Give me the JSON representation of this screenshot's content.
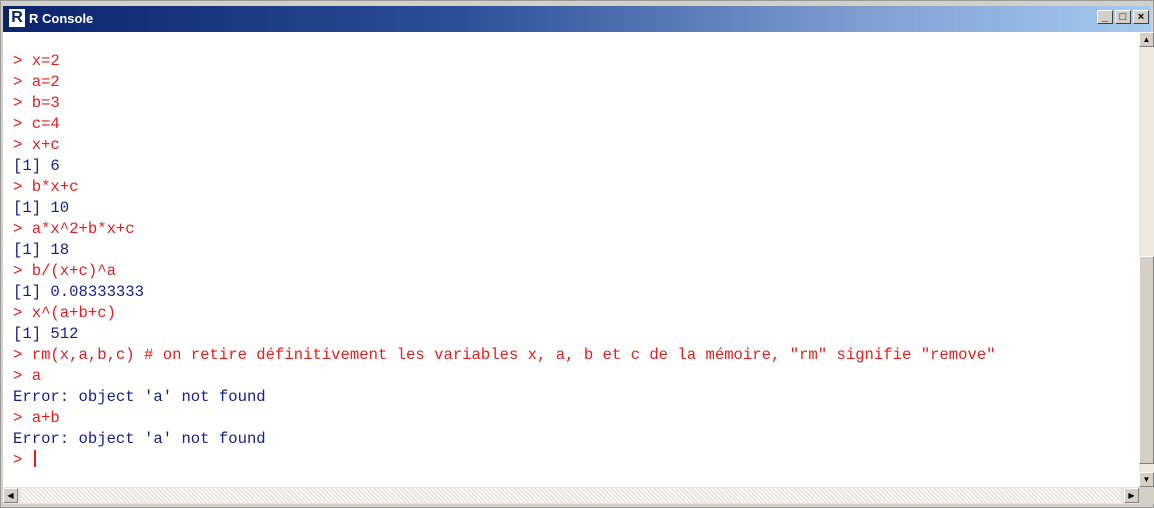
{
  "window": {
    "title": "R Console",
    "app_icon": "R",
    "controls": {
      "minimize": "_",
      "maximize": "□",
      "close": "×"
    }
  },
  "console": {
    "lines": [
      {
        "type": "cmd",
        "text": "> x=2"
      },
      {
        "type": "cmd",
        "text": "> a=2"
      },
      {
        "type": "cmd",
        "text": "> b=3"
      },
      {
        "type": "cmd",
        "text": "> c=4"
      },
      {
        "type": "cmd",
        "text": "> x+c"
      },
      {
        "type": "out",
        "text": "[1] 6"
      },
      {
        "type": "cmd",
        "text": "> b*x+c"
      },
      {
        "type": "out",
        "text": "[1] 10"
      },
      {
        "type": "cmd",
        "text": "> a*x^2+b*x+c"
      },
      {
        "type": "out",
        "text": "[1] 18"
      },
      {
        "type": "cmd",
        "text": "> b/(x+c)^a"
      },
      {
        "type": "out",
        "text": "[1] 0.08333333"
      },
      {
        "type": "cmd",
        "text": "> x^(a+b+c)"
      },
      {
        "type": "out",
        "text": "[1] 512"
      },
      {
        "type": "cmd",
        "text": "> rm(x,a,b,c) # on retire définitivement les variables x, a, b et c de la mémoire, \"rm\" signifie \"remove\""
      },
      {
        "type": "cmd",
        "text": "> a"
      },
      {
        "type": "out",
        "text": "Error: object 'a' not found"
      },
      {
        "type": "cmd",
        "text": "> a+b"
      },
      {
        "type": "out",
        "text": "Error: object 'a' not found"
      }
    ],
    "prompt": "> "
  },
  "colors": {
    "command": "#e22020",
    "output": "#1a1e88",
    "titlebar": "#0a246a"
  }
}
